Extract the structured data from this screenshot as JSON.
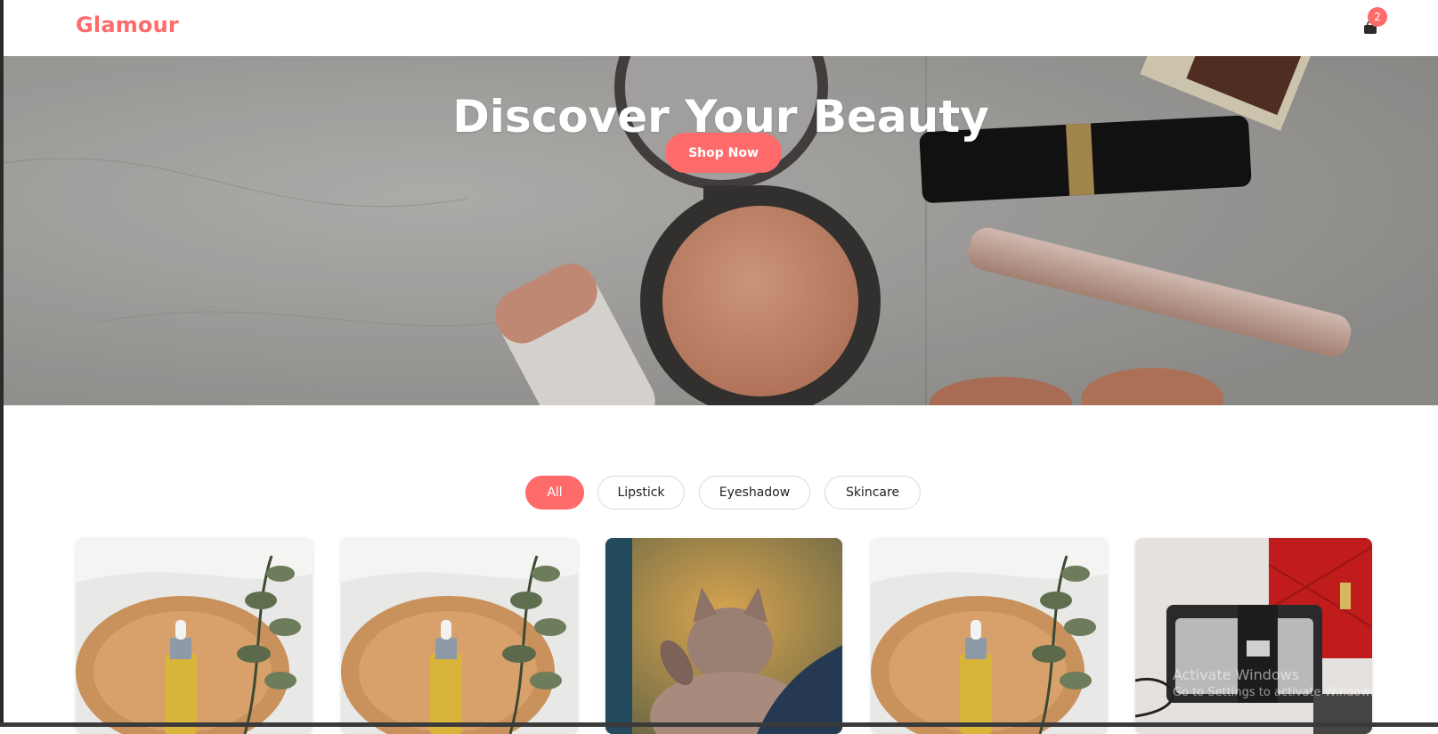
{
  "brand": {
    "name": "Glamour",
    "accent": "#ff6b6b"
  },
  "cart": {
    "icon": "shopping-bag-icon",
    "count": "2"
  },
  "hero": {
    "title": "Discover Your Beauty",
    "cta_label": "Shop Now"
  },
  "filters": [
    {
      "label": "All",
      "active": true
    },
    {
      "label": "Lipstick",
      "active": false
    },
    {
      "label": "Eyeshadow",
      "active": false
    },
    {
      "label": "Skincare",
      "active": false
    }
  ],
  "products": [
    {
      "image": "serum-bottle-on-wood"
    },
    {
      "image": "serum-bottle-on-wood"
    },
    {
      "image": "cat-photo"
    },
    {
      "image": "serum-bottle-on-wood"
    },
    {
      "image": "handbags-photo"
    }
  ],
  "os_watermark": {
    "line1": "Activate Windows",
    "line2": "Go to Settings to activate Windows."
  }
}
